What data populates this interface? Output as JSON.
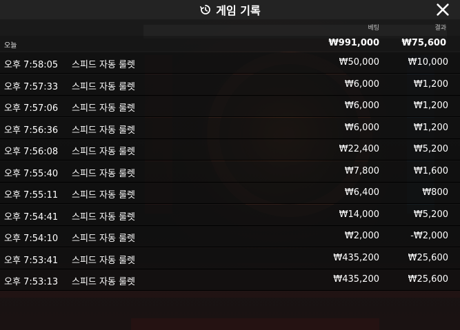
{
  "header": {
    "title": "게임 기록"
  },
  "columns": {
    "bet": "베팅",
    "result": "결과"
  },
  "summary": {
    "label": "오늘",
    "bet": "₩991,000",
    "result": "₩75,600"
  },
  "rows": [
    {
      "time": "오후 7:58:05",
      "game": "스피드 자동 룰렛",
      "bet": "₩50,000",
      "result": "₩10,000"
    },
    {
      "time": "오후 7:57:33",
      "game": "스피드 자동 룰렛",
      "bet": "₩6,000",
      "result": "₩1,200"
    },
    {
      "time": "오후 7:57:06",
      "game": "스피드 자동 룰렛",
      "bet": "₩6,000",
      "result": "₩1,200"
    },
    {
      "time": "오후 7:56:36",
      "game": "스피드 자동 룰렛",
      "bet": "₩6,000",
      "result": "₩1,200"
    },
    {
      "time": "오후 7:56:08",
      "game": "스피드 자동 룰렛",
      "bet": "₩22,400",
      "result": "₩5,200"
    },
    {
      "time": "오후 7:55:40",
      "game": "스피드 자동 룰렛",
      "bet": "₩7,800",
      "result": "₩1,600"
    },
    {
      "time": "오후 7:55:11",
      "game": "스피드 자동 룰렛",
      "bet": "₩6,400",
      "result": "₩800"
    },
    {
      "time": "오후 7:54:41",
      "game": "스피드 자동 룰렛",
      "bet": "₩14,000",
      "result": "₩5,200"
    },
    {
      "time": "오후 7:54:10",
      "game": "스피드 자동 룰렛",
      "bet": "₩2,000",
      "result": "-₩2,000"
    },
    {
      "time": "오후 7:53:41",
      "game": "스피드 자동 룰렛",
      "bet": "₩435,200",
      "result": "₩25,600"
    },
    {
      "time": "오후 7:53:13",
      "game": "스피드 자동 룰렛",
      "bet": "₩435,200",
      "result": "₩25,600"
    }
  ],
  "icons": {
    "history": "history-icon",
    "close": "close-icon"
  }
}
